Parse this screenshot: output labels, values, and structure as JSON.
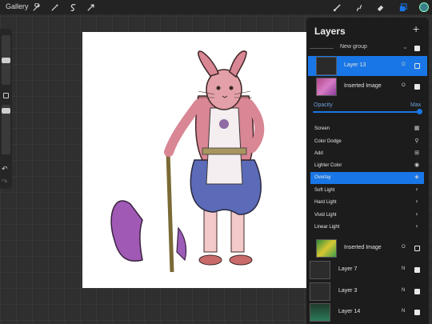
{
  "topbar": {
    "gallery_label": "Gallery",
    "left_tools": [
      "wrench-icon",
      "magic-wand-icon",
      "selection-icon",
      "transform-icon"
    ],
    "right_tools": [
      "brush-icon",
      "smudge-icon",
      "eraser-icon",
      "layers-icon"
    ],
    "color": "#3a7f8a"
  },
  "layers_panel": {
    "title": "Layers",
    "add_label": "+",
    "group_label": "New group",
    "layers_top": [
      {
        "name": "Layer 13",
        "mode": "O",
        "visible": false,
        "selected": true
      },
      {
        "name": "Inserted Image",
        "mode": "O",
        "visible": true,
        "selected": false
      }
    ],
    "opacity_label": "Opacity",
    "opacity_max": "Max",
    "blend_modes": [
      {
        "label": "Screen",
        "icon": "▦"
      },
      {
        "label": "Color Dodge",
        "icon": "⚲"
      },
      {
        "label": "Add",
        "icon": "⊞"
      },
      {
        "label": "Lighter Color",
        "icon": "◉"
      },
      {
        "label": "Overlay",
        "icon": "◈",
        "selected": true
      },
      {
        "label": "Soft Light",
        "icon": "♀"
      },
      {
        "label": "Hard Light",
        "icon": "♀"
      },
      {
        "label": "Vivid Light",
        "icon": "♀"
      },
      {
        "label": "Linear Light",
        "icon": "♀"
      }
    ],
    "layers_bottom": [
      {
        "name": "Inserted Image",
        "mode": "O",
        "visible": false
      },
      {
        "name": "Layer 7",
        "mode": "N",
        "visible": true
      },
      {
        "name": "Layer 3",
        "mode": "N",
        "visible": true
      },
      {
        "name": "Layer 14",
        "mode": "N",
        "visible": true
      }
    ]
  }
}
